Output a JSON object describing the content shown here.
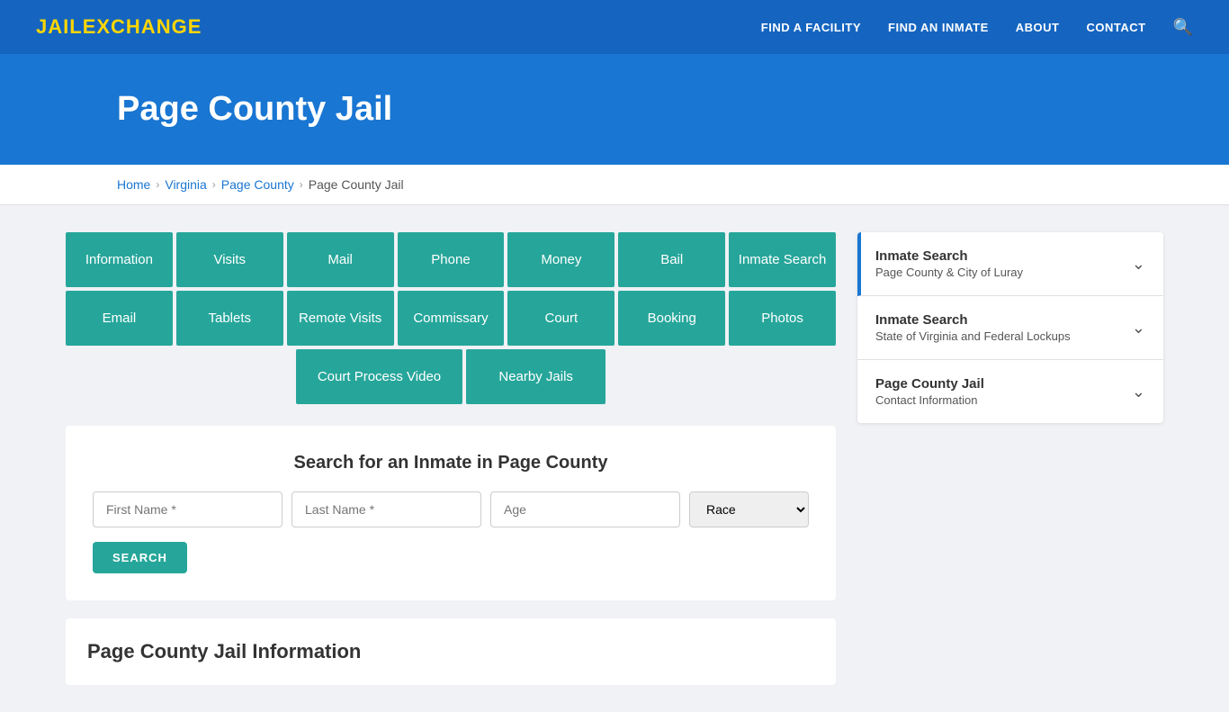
{
  "header": {
    "logo_jail": "JAIL",
    "logo_exchange": "EXCHANGE",
    "nav": [
      {
        "label": "FIND A FACILITY",
        "id": "find-facility"
      },
      {
        "label": "FIND AN INMATE",
        "id": "find-inmate"
      },
      {
        "label": "ABOUT",
        "id": "about"
      },
      {
        "label": "CONTACT",
        "id": "contact"
      }
    ]
  },
  "hero": {
    "title": "Page County Jail"
  },
  "breadcrumb": [
    {
      "label": "Home",
      "href": "#"
    },
    {
      "label": "Virginia",
      "href": "#"
    },
    {
      "label": "Page County",
      "href": "#"
    },
    {
      "label": "Page County Jail",
      "href": "#"
    }
  ],
  "button_grid_row1": [
    "Information",
    "Visits",
    "Mail",
    "Phone",
    "Money",
    "Bail",
    "Inmate Search"
  ],
  "button_grid_row2": [
    "Email",
    "Tablets",
    "Remote Visits",
    "Commissary",
    "Court",
    "Booking",
    "Photos"
  ],
  "button_grid_row3": [
    "Court Process Video",
    "Nearby Jails"
  ],
  "search": {
    "title": "Search for an Inmate in Page County",
    "first_name_placeholder": "First Name *",
    "last_name_placeholder": "Last Name *",
    "age_placeholder": "Age",
    "race_placeholder": "Race",
    "button_label": "SEARCH"
  },
  "info_section": {
    "title": "Page County Jail Information"
  },
  "sidebar": {
    "items": [
      {
        "id": "inmate-search-page",
        "title": "Inmate Search",
        "subtitle": "Page County & City of Luray",
        "active": true
      },
      {
        "id": "inmate-search-state",
        "title": "Inmate Search",
        "subtitle": "State of Virginia and Federal Lockups",
        "active": false
      },
      {
        "id": "contact-info",
        "title": "Page County Jail",
        "subtitle": "Contact Information",
        "active": false
      }
    ]
  }
}
